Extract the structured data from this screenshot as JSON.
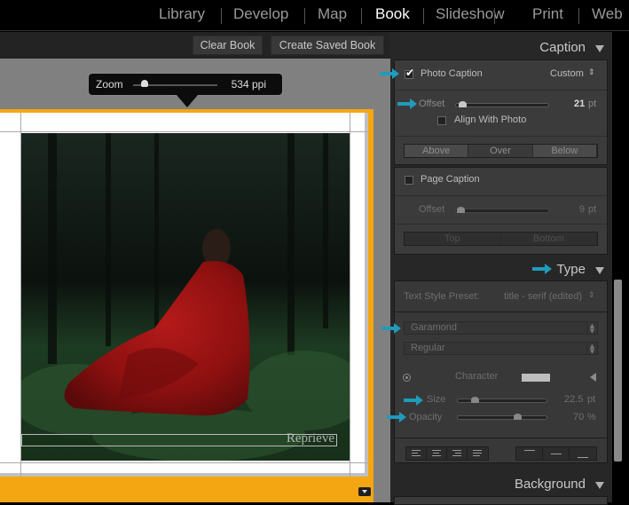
{
  "topnav": {
    "modules": [
      {
        "label": "Library",
        "active": false
      },
      {
        "label": "Develop",
        "active": false
      },
      {
        "label": "Map",
        "active": false
      },
      {
        "label": "Book",
        "active": true
      },
      {
        "label": "Slideshow",
        "active": false
      },
      {
        "label": "Print",
        "active": false
      },
      {
        "label": "Web",
        "active": false
      }
    ]
  },
  "toolbar": {
    "clear_book": "Clear Book",
    "create_saved_book": "Create Saved Book"
  },
  "zoom_popup": {
    "label": "Zoom",
    "value": "534 ppi",
    "slider_fraction": 0.12
  },
  "page": {
    "caption_text": "Reprieve",
    "accent_color": "#f4a612"
  },
  "caption_panel": {
    "title": "Caption",
    "photo_caption": {
      "label": "Photo Caption",
      "checked": true,
      "preset": "Custom"
    },
    "offset": {
      "label": "Offset",
      "value": "21",
      "unit": "pt",
      "fraction": 0.05
    },
    "align_with_photo": {
      "label": "Align With Photo",
      "checked": false
    },
    "position_buttons": [
      "Above",
      "Over",
      "Below"
    ],
    "page_caption": {
      "label": "Page Caption",
      "checked": false
    },
    "page_offset": {
      "label": "Offset",
      "value": "9",
      "unit": "pt",
      "fraction": 0.02
    },
    "page_position_buttons": [
      "Top",
      "Bottom"
    ]
  },
  "type_panel": {
    "title": "Type",
    "text_style_preset_label": "Text Style Preset:",
    "text_style_preset_value": "title - serif (edited)",
    "font_family": "Garamond",
    "font_style": "Regular",
    "character_label": "Character",
    "character_color": "#bdbdbd",
    "size": {
      "label": "Size",
      "value": "22.5",
      "unit": "pt",
      "fraction": 0.18
    },
    "opacity": {
      "label": "Opacity",
      "value": "70",
      "unit": "%",
      "fraction": 0.68
    }
  },
  "background_panel": {
    "title": "Background"
  },
  "annotation_color": "#1f9bbd"
}
